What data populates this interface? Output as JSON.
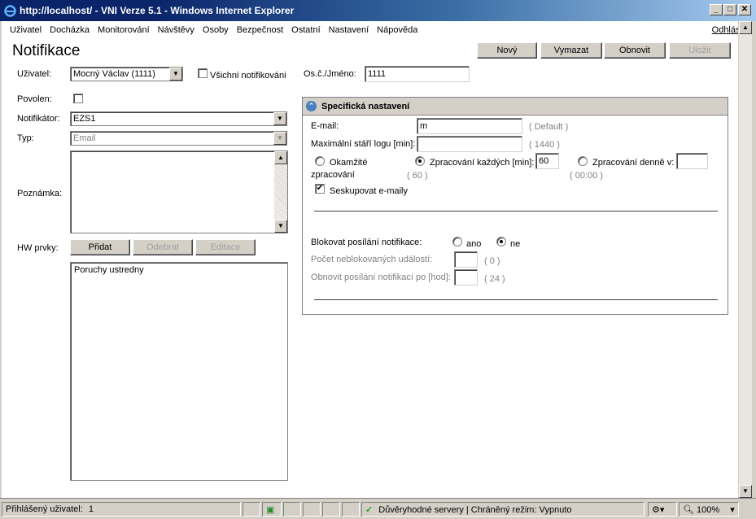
{
  "window": {
    "title": "http://localhost/ - VNI Verze 5.1 - Windows Internet Explorer"
  },
  "menu": {
    "items": [
      "Uživatel",
      "Docházka",
      "Monitorování",
      "Návštěvy",
      "Osoby",
      "Bezpečnost",
      "Ostatní",
      "Nastavení",
      "Nápověda"
    ],
    "logout": "Odhlásit"
  },
  "page": {
    "title": "Notifikace"
  },
  "toolbar": {
    "new": "Nový",
    "delete": "Vymazat",
    "refresh": "Obnovit",
    "save": "Uložit"
  },
  "form": {
    "user_label": "Uživatel:",
    "user_value": "Mocný Václav (1111)",
    "all_notified_label": "Všichni notifikováni",
    "osc_label": "Os.č./Jméno:",
    "osc_value": "1111",
    "enabled_label": "Povolen:",
    "notifier_label": "Notifikátor:",
    "notifier_value": "EZS1",
    "type_label": "Typ:",
    "type_value": "Email",
    "note_label": "Poznámka:",
    "hw_label": "HW prvky:",
    "hw_add": "Přidat",
    "hw_remove": "Odebrat",
    "hw_edit": "Editace",
    "hw_items": [
      "Poruchy ustredny"
    ]
  },
  "specific": {
    "header": "Specifická nastavení",
    "email_label": "E-mail:",
    "email_value": "m",
    "email_default": "( Default )",
    "maxage_label": "Maximální stáří logu [min]:",
    "maxage_value": "",
    "maxage_default": "( 1440 )",
    "radio_immediate_1": "Okamžité",
    "radio_immediate_2": "zpracování",
    "radio_every_label": "Zpracování každých [min]:",
    "radio_every_value": "60",
    "radio_every_default": "( 60 )",
    "radio_daily_label": "Zpracování denně v:",
    "radio_daily_value": "",
    "radio_daily_default": "( 00:00 )",
    "group_emails_label": "Seskupovat e-maily",
    "block_label": "Blokovat posílání notifikace:",
    "block_yes": "ano",
    "block_no": "ne",
    "unblocked_count_label": "Počet neblokovaných událostí:",
    "unblocked_count_default": "( 0 )",
    "renew_label": "Obnovit posílání notifikací po [hod]:",
    "renew_default": "( 24 )"
  },
  "statusbar": {
    "user_label": "Přihlášený uživatel:",
    "user_value": "1",
    "zone": "Důvěryhodné servery | Chráněný režim: Vypnuto",
    "zoom": "100%"
  }
}
